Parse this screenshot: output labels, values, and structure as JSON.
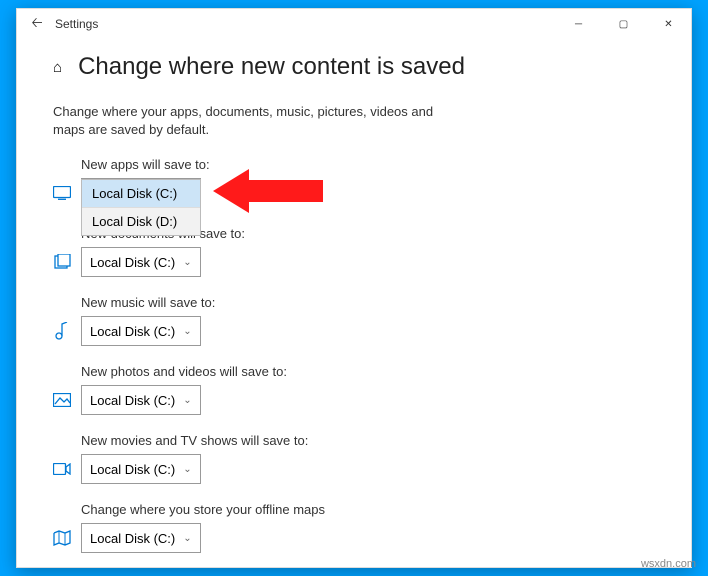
{
  "window": {
    "app_name": "Settings"
  },
  "page": {
    "title": "Change where new content is saved",
    "description": "Change where your apps, documents, music, pictures, videos and maps are saved by default."
  },
  "dropdown_options": [
    "Local Disk (C:)",
    "Local Disk (D:)"
  ],
  "groups": [
    {
      "label": "New apps will save to:",
      "value": "Local Disk (C:)",
      "open": true
    },
    {
      "label": "New documents will save to:",
      "value": "Local Disk (C:)"
    },
    {
      "label": "New music will save to:",
      "value": "Local Disk (C:)"
    },
    {
      "label": "New photos and videos will save to:",
      "value": "Local Disk (C:)"
    },
    {
      "label": "New movies and TV shows will save to:",
      "value": "Local Disk (C:)"
    },
    {
      "label": "Change where you store your offline maps",
      "value": "Local Disk (C:)"
    }
  ],
  "colors": {
    "accent": "#ff1a1a",
    "icon": "#0078d4"
  },
  "watermark": "wsxdn.com"
}
